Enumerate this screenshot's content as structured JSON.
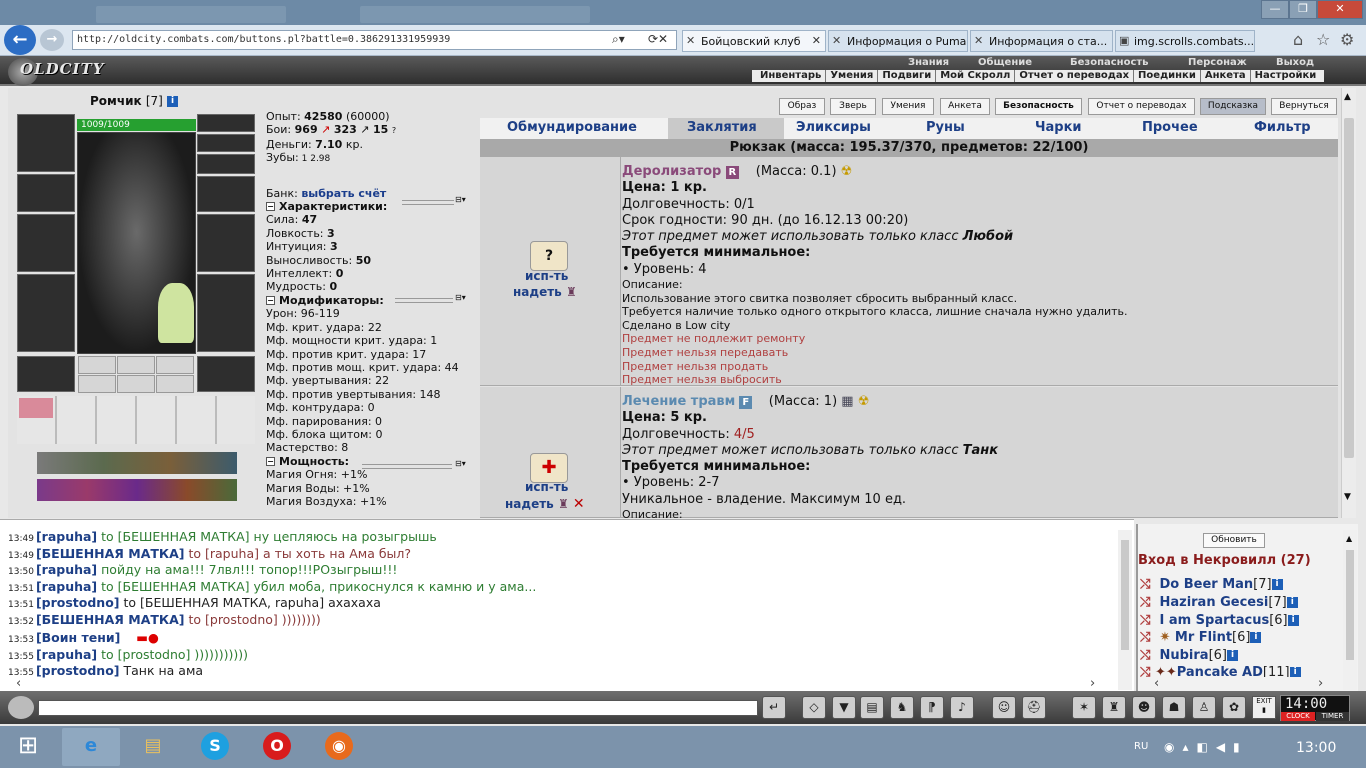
{
  "browser": {
    "url": "http://oldcity.combats.com/buttons.pl?battle=0.386291331959939",
    "tabs": [
      {
        "label": "Бойцовский клуб",
        "active": true
      },
      {
        "label": "Информация о Puma",
        "active": false
      },
      {
        "label": "Информация о ста...",
        "active": false
      },
      {
        "label": "img.scrolls.combats....",
        "active": false
      }
    ]
  },
  "game_menu": {
    "logo": "OLDCITY",
    "top_items": [
      "Знания",
      "Общение",
      "Безопасность",
      "Персонаж",
      "Выход"
    ],
    "sub_items": [
      "Инвентарь",
      "Умения",
      "Подвиги",
      "Мой Скролл",
      "Отчет о переводах",
      "Поединки",
      "Анкета",
      "Настройки"
    ]
  },
  "character": {
    "name": "Ромчик",
    "level": "[7]",
    "hp": "1009/1009",
    "exp_label": "Опыт:",
    "exp": "42580",
    "exp_next": "(60000)",
    "battles_label": "Бои:",
    "wins": "969",
    "losses": "323",
    "draws": "15",
    "money_label": "Деньги:",
    "money": "7.10",
    "money_unit": "кр.",
    "teeth_label": "Зубы:",
    "teeth_value": "1 2.98",
    "bank_label": "Банк:",
    "bank_link": "выбрать счёт",
    "chars_header": "Характеристики:",
    "chars": [
      {
        "label": "Сила:",
        "value": "47"
      },
      {
        "label": "Ловкость:",
        "value": "3"
      },
      {
        "label": "Интуиция:",
        "value": "3"
      },
      {
        "label": "Выносливость:",
        "value": "50"
      },
      {
        "label": "Интеллект:",
        "value": "0"
      },
      {
        "label": "Мудрость:",
        "value": "0"
      }
    ],
    "mods_header": "Модификаторы:",
    "mods": [
      "Урон: 96-119",
      "Мф. крит. удара: 22",
      "Мф. мощности крит. удара: 1",
      "Мф. против крит. удара: 17",
      "Мф. против мощ. крит. удара: 44",
      "Мф. увертывания: 22",
      "Мф. против увертывания: 148",
      "Мф. контрудара: 0",
      "Мф. парирования: 0",
      "Мф. блока щитом: 0",
      "Мастерство: 8"
    ],
    "power_header": "Мощность:",
    "power": [
      "Магия Огня: +1%",
      "Магия Воды: +1%",
      "Магия Воздуха: +1%"
    ]
  },
  "top_buttons": [
    "Образ",
    "Зверь",
    "Умения",
    "Анкета",
    "Безопасность",
    "Отчет о переводах",
    "Подсказка",
    "Вернуться"
  ],
  "inventory_tabs": [
    "Обмундирование",
    "Заклятия",
    "Эликсиры",
    "Руны",
    "Чарки",
    "Прочее",
    "Фильтр"
  ],
  "backpack": "Рюкзак (масса: 195.37/370, предметов: 22/100)",
  "items": [
    {
      "name": "Деролизатор",
      "badge": "R",
      "mass": "(Масса: 0.1)",
      "action1": "исп-ть",
      "action2": "надеть",
      "price": "Цена: 1 кр.",
      "durability": "Долговечность: 0/1",
      "expiry": "Срок годности: 90 дн. (до 16.12.13 00:20)",
      "class_text": "Этот предмет может использовать только класс ",
      "class_name": "Любой",
      "req": "Требуется минимальное:",
      "level": "• Уровень: 4",
      "desc_label": "Описание:",
      "desc1": "Использование этого свитка позволяет сбросить выбранный класс.",
      "desc2": "Требуется наличие только одного открытого класса, лишние сначала нужно удалить.",
      "made": "Сделано в Low city",
      "notes": [
        "Предмет не подлежит ремонту",
        "Предмет нельзя передавать",
        "Предмет нельзя продать",
        "Предмет нельзя выбросить"
      ]
    },
    {
      "name": "Лечение травм",
      "badge": "F",
      "mass": "(Масса: 1)",
      "action1": "исп-ть",
      "action2": "надеть",
      "price": "Цена: 5 кр.",
      "durability_label": "Долговечность: ",
      "durability_value": "4/5",
      "class_text": "Этот предмет может использовать только класс ",
      "class_name": "Танк",
      "req": "Требуется минимальное:",
      "level": "• Уровень: 2-7",
      "unique": "Уникальное - владение. Максимум 10 ед.",
      "desc_label": "Описание:"
    }
  ],
  "chat": [
    {
      "time": "13:49",
      "from": "[rapuha]",
      "text": " to [БЕШЕННАЯ МАТКА] ну цепляюсь на розыгрышь",
      "color": "green"
    },
    {
      "time": "13:49",
      "from": "[БЕШЕННАЯ МАТКА]",
      "text": " to [rapuha] а ты хоть на Ама был?",
      "color": "brown"
    },
    {
      "time": "13:50",
      "from": "[rapuha]",
      "text": " пойду на ама!!! 7лвл!!! топор!!!РОзыгрыш!!!",
      "color": "green"
    },
    {
      "time": "13:51",
      "from": "[rapuha]",
      "text": " to [БЕШЕННАЯ МАТКА] убил моба, прикоснулся к камню и у ама...",
      "color": "green"
    },
    {
      "time": "13:51",
      "from": "[prostodno]",
      "text": " to [БЕШЕННАЯ МАТКА, rapuha] ахахаха",
      "color": "black"
    },
    {
      "time": "13:52",
      "from": "[БЕШЕННАЯ МАТКА]",
      "text": " to [prostodno] ))))))))",
      "color": "brown"
    },
    {
      "time": "13:53",
      "from": "[Воин тени]",
      "text": "",
      "color": "black"
    },
    {
      "time": "13:55",
      "from": "[rapuha]",
      "text": " to [prostodno] )))))))))))",
      "color": "green"
    },
    {
      "time": "13:55",
      "from": "[prostodno]",
      "text": " Танк на ама",
      "color": "black"
    }
  ],
  "online": {
    "refresh": "Обновить",
    "title": "Вход в Некровилл (27)",
    "users": [
      {
        "name": "Do Beer Man",
        "level": "[7]"
      },
      {
        "name": "Haziran Gecesi",
        "level": "[7]"
      },
      {
        "name": "I am Spartacus",
        "level": "[6]"
      },
      {
        "name": "Mr Flint",
        "level": "[6]"
      },
      {
        "name": "Nubira",
        "level": "[6]"
      },
      {
        "name": "Pancake AD",
        "level": "[11]"
      }
    ]
  },
  "toolbar": {
    "clock": "14:00",
    "clock_label": "CLOCK",
    "timer_label": "TIMER",
    "exit_label": "EXIT"
  },
  "taskbar": {
    "lang": "RU",
    "time": "13:00"
  },
  "colors": {
    "link": "#1d3f86",
    "chat_green": "#2e7d32",
    "chat_brown": "#8a3a3a",
    "hp_bar": "#26a030"
  }
}
